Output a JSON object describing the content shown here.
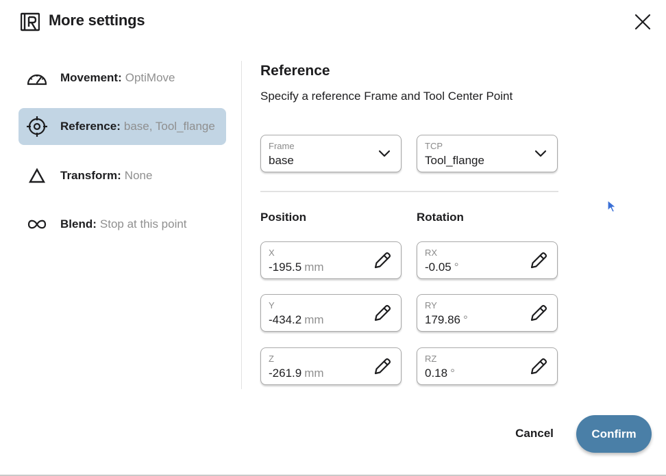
{
  "header": {
    "title": "More settings",
    "logo_icon": "ur-logo-icon",
    "close_icon": "close-icon"
  },
  "nav": {
    "items": [
      {
        "key": "Movement:",
        "value": "OptiMove",
        "icon": "speedometer-icon",
        "active": false
      },
      {
        "key": "Reference:",
        "value": "base, Tool_flange",
        "icon": "target-icon",
        "active": true
      },
      {
        "key": "Transform:",
        "value": "None",
        "icon": "delta-icon",
        "active": false
      },
      {
        "key": "Blend:",
        "value": "Stop at this point",
        "icon": "infinity-icon",
        "active": false
      }
    ]
  },
  "reference": {
    "title": "Reference",
    "description": "Specify a reference Frame and Tool Center Point",
    "frame": {
      "label": "Frame",
      "value": "base"
    },
    "tcp": {
      "label": "TCP",
      "value": "Tool_flange"
    }
  },
  "position": {
    "heading": "Position",
    "fields": [
      {
        "label": "X",
        "value": "-195.5",
        "unit": "mm"
      },
      {
        "label": "Y",
        "value": "-434.2",
        "unit": "mm"
      },
      {
        "label": "Z",
        "value": "-261.9",
        "unit": "mm"
      }
    ]
  },
  "rotation": {
    "heading": "Rotation",
    "fields": [
      {
        "label": "RX",
        "value": "-0.05",
        "unit": "°"
      },
      {
        "label": "RY",
        "value": "179.86",
        "unit": "°"
      },
      {
        "label": "RZ",
        "value": "0.18",
        "unit": "°"
      }
    ]
  },
  "footer": {
    "cancel_label": "Cancel",
    "confirm_label": "Confirm"
  },
  "colors": {
    "accent": "#4a7fa7",
    "active_nav_bg": "#c2d5e4",
    "muted_text": "#8f8f8f"
  }
}
